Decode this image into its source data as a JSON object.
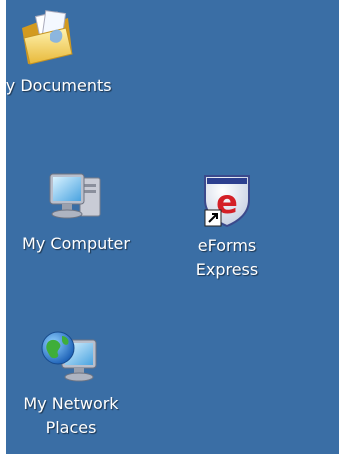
{
  "desktop": {
    "background_color": "#3a6ea5",
    "icons": [
      {
        "icon": "folder-documents-icon",
        "label_lines": [
          "My Documents"
        ]
      },
      {
        "icon": "computer-icon",
        "label_lines": [
          "My Computer"
        ]
      },
      {
        "icon": "eforms-express-icon",
        "shortcut": true,
        "label_lines": [
          "eForms",
          "Express"
        ]
      },
      {
        "icon": "network-places-icon",
        "label_lines": [
          "My Network",
          "Places"
        ]
      }
    ]
  }
}
